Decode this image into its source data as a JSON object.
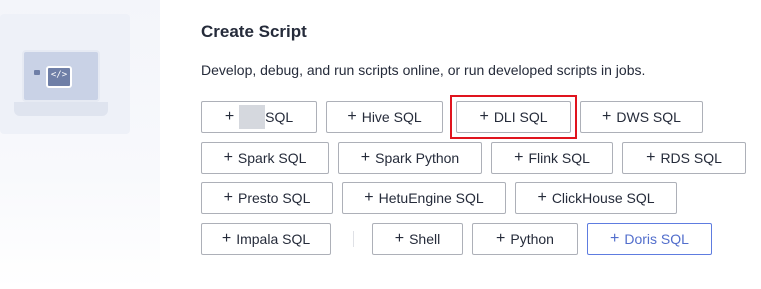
{
  "header": {
    "title": "Create Script",
    "description": "Develop, debug, and run scripts online, or run developed scripts in jobs."
  },
  "illustration": {
    "code_glyph": "</>"
  },
  "buttons": {
    "redacted_sql": {
      "label": "SQL"
    },
    "hive_sql": {
      "label": "Hive SQL"
    },
    "dli_sql": {
      "label": "DLI SQL"
    },
    "dws_sql": {
      "label": "DWS SQL"
    },
    "spark_sql": {
      "label": "Spark SQL"
    },
    "spark_python": {
      "label": "Spark Python"
    },
    "flink_sql": {
      "label": "Flink SQL"
    },
    "rds_sql": {
      "label": "RDS SQL"
    },
    "presto_sql": {
      "label": "Presto SQL"
    },
    "hetuengine_sql": {
      "label": "HetuEngine SQL"
    },
    "clickhouse_sql": {
      "label": "ClickHouse SQL"
    },
    "impala_sql": {
      "label": "Impala SQL"
    },
    "shell": {
      "label": "Shell"
    },
    "python": {
      "label": "Python"
    },
    "doris_sql": {
      "label": "Doris SQL"
    }
  },
  "plus_symbol": "+",
  "colors": {
    "highlight": "#e0141e",
    "doris_accent": "#526ecc"
  }
}
